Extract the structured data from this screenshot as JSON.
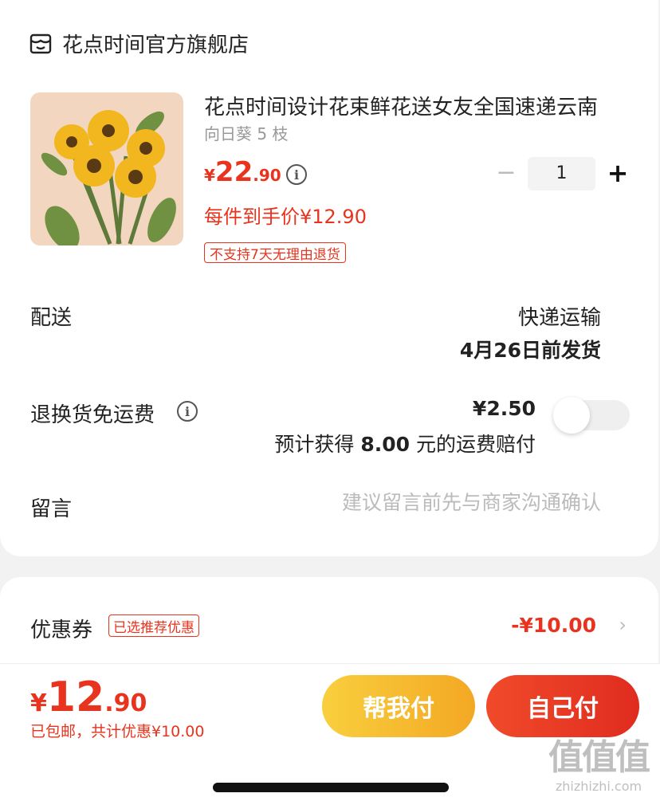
{
  "store": {
    "name": "花点时间官方旗舰店",
    "icon": "store-icon"
  },
  "product": {
    "title": "花点时间设计花束鲜花送女友全国速递云南",
    "sku": "向日葵 5 枝",
    "price_symbol": "¥",
    "price_int": "22",
    "price_dec": ".90",
    "final_price": "每件到手价¥12.90",
    "return_tag": "不支持7天无理由退货",
    "quantity": "1",
    "minus": "−",
    "plus": "+"
  },
  "delivery": {
    "label": "配送",
    "method": "快递运输",
    "date": "4月26日前发货"
  },
  "return_insurance": {
    "label": "退换货免运费",
    "price": "¥2.50",
    "comp_prefix": "预计获得 ",
    "comp_amount": "8.00",
    "comp_suffix": " 元的运费赔付",
    "enabled": false
  },
  "message": {
    "label": "留言",
    "placeholder": "建议留言前先与商家沟通确认"
  },
  "coupon": {
    "label": "优惠券",
    "tag": "已选推荐优惠",
    "value": "-¥10.00",
    "chevron": "›"
  },
  "footer": {
    "total_symbol": "¥",
    "total_int": "12",
    "total_dec": ".90",
    "total_sub": "已包邮，共计优惠¥10.00",
    "help_pay": "帮我付",
    "self_pay": "自己付"
  },
  "watermark": {
    "big": "值值值",
    "small": "zhizhizhi.com"
  },
  "colors": {
    "accent": "#e8331e",
    "help_btn": "#f5b82e",
    "self_btn": "#e8331e"
  }
}
